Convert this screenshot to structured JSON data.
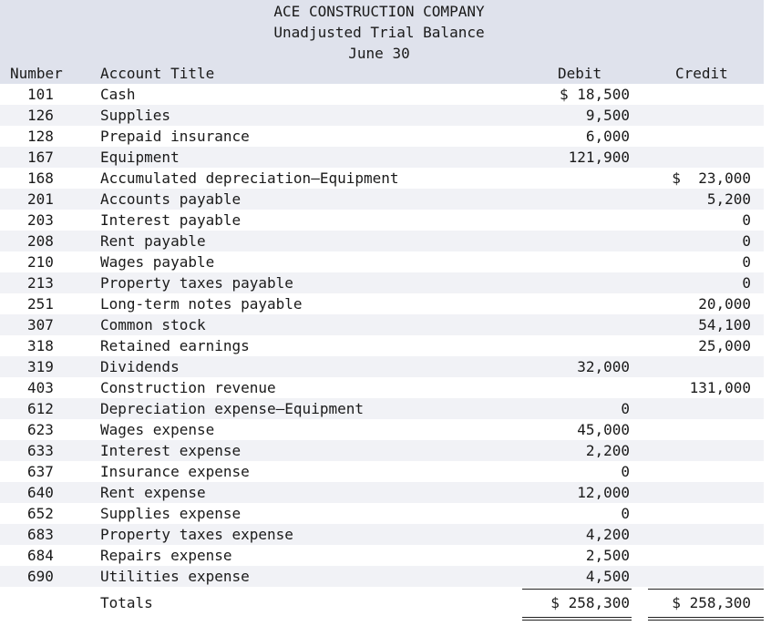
{
  "header": {
    "company": "ACE CONSTRUCTION COMPANY",
    "report": "Unadjusted Trial Balance",
    "date": "June 30"
  },
  "columns": {
    "number": "Number",
    "title": "Account Title",
    "debit": "Debit",
    "credit": "Credit"
  },
  "rows": [
    {
      "number": "101",
      "title": "Cash",
      "debit": "$ 18,500",
      "credit": ""
    },
    {
      "number": "126",
      "title": "Supplies",
      "debit": "9,500",
      "credit": ""
    },
    {
      "number": "128",
      "title": "Prepaid insurance",
      "debit": "6,000",
      "credit": ""
    },
    {
      "number": "167",
      "title": "Equipment",
      "debit": "121,900",
      "credit": ""
    },
    {
      "number": "168",
      "title": "Accumulated depreciation—Equipment",
      "debit": "",
      "credit": "$  23,000"
    },
    {
      "number": "201",
      "title": "Accounts payable",
      "debit": "",
      "credit": "5,200"
    },
    {
      "number": "203",
      "title": "Interest payable",
      "debit": "",
      "credit": "0"
    },
    {
      "number": "208",
      "title": "Rent payable",
      "debit": "",
      "credit": "0"
    },
    {
      "number": "210",
      "title": "Wages payable",
      "debit": "",
      "credit": "0"
    },
    {
      "number": "213",
      "title": "Property taxes payable",
      "debit": "",
      "credit": "0"
    },
    {
      "number": "251",
      "title": "Long-term notes payable",
      "debit": "",
      "credit": "20,000"
    },
    {
      "number": "307",
      "title": "Common stock",
      "debit": "",
      "credit": "54,100"
    },
    {
      "number": "318",
      "title": "Retained earnings",
      "debit": "",
      "credit": "25,000"
    },
    {
      "number": "319",
      "title": "Dividends",
      "debit": "32,000",
      "credit": ""
    },
    {
      "number": "403",
      "title": "Construction revenue",
      "debit": "",
      "credit": "131,000"
    },
    {
      "number": "612",
      "title": "Depreciation expense—Equipment",
      "debit": "0",
      "credit": ""
    },
    {
      "number": "623",
      "title": "Wages expense",
      "debit": "45,000",
      "credit": ""
    },
    {
      "number": "633",
      "title": "Interest expense",
      "debit": "2,200",
      "credit": ""
    },
    {
      "number": "637",
      "title": "Insurance expense",
      "debit": "0",
      "credit": ""
    },
    {
      "number": "640",
      "title": "Rent expense",
      "debit": "12,000",
      "credit": ""
    },
    {
      "number": "652",
      "title": "Supplies expense",
      "debit": "0",
      "credit": ""
    },
    {
      "number": "683",
      "title": "Property taxes expense",
      "debit": "4,200",
      "credit": ""
    },
    {
      "number": "684",
      "title": "Repairs expense",
      "debit": "2,500",
      "credit": ""
    },
    {
      "number": "690",
      "title": "Utilities expense",
      "debit": "4,500",
      "credit": ""
    }
  ],
  "totals": {
    "label": "Totals",
    "debit": "$ 258,300",
    "credit": "$ 258,300"
  }
}
